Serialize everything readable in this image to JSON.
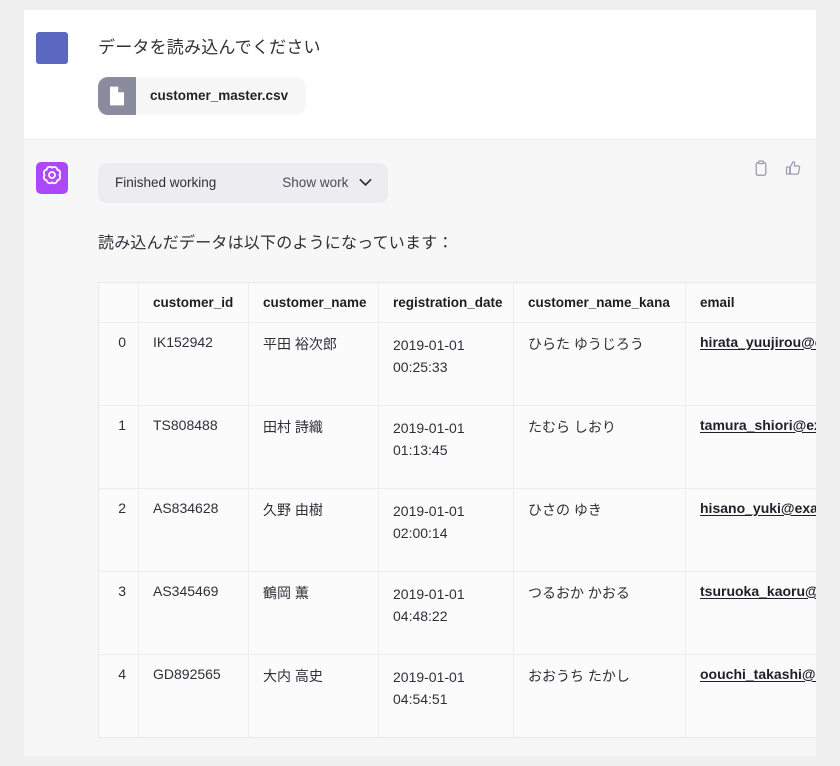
{
  "user_turn": {
    "avatar_color": "#5b68c0",
    "message": "データを読み込んでください",
    "attachment": {
      "filename": "customer_master.csv",
      "icon": "file-document-icon"
    }
  },
  "assistant_turn": {
    "avatar_color": "#ab47fc",
    "avatar_icon": "openai-logo-icon",
    "work_bar": {
      "status": "Finished working",
      "toggle_label": "Show work",
      "toggle_icon": "chevron-down-icon"
    },
    "actions": [
      {
        "name": "copy-icon",
        "label": "Copy"
      },
      {
        "name": "thumbs-up-icon",
        "label": "Good response"
      }
    ],
    "message": "読み込んだデータは以下のようになっています："
  },
  "table": {
    "index_header": "",
    "columns": [
      "customer_id",
      "customer_name",
      "registration_date",
      "customer_name_kana",
      "email"
    ],
    "rows": [
      {
        "index": "0",
        "customer_id": "IK152942",
        "customer_name": "平田 裕次郎",
        "registration_date_date": "2019-01-01",
        "registration_date_time": "00:25:33",
        "customer_name_kana": "ひらた ゆうじろう",
        "email": "hirata_yuujirou@example.com"
      },
      {
        "index": "1",
        "customer_id": "TS808488",
        "customer_name": "田村 詩織",
        "registration_date_date": "2019-01-01",
        "registration_date_time": "01:13:45",
        "customer_name_kana": "たむら しおり",
        "email": "tamura_shiori@example.com"
      },
      {
        "index": "2",
        "customer_id": "AS834628",
        "customer_name": "久野 由樹",
        "registration_date_date": "2019-01-01",
        "registration_date_time": "02:00:14",
        "customer_name_kana": "ひさの ゆき",
        "email": "hisano_yuki@example.com"
      },
      {
        "index": "3",
        "customer_id": "AS345469",
        "customer_name": "鶴岡 薫",
        "registration_date_date": "2019-01-01",
        "registration_date_time": "04:48:22",
        "customer_name_kana": "つるおか かおる",
        "email": "tsuruoka_kaoru@example.com"
      },
      {
        "index": "4",
        "customer_id": "GD892565",
        "customer_name": "大内 高史",
        "registration_date_date": "2019-01-01",
        "registration_date_time": "04:54:51",
        "customer_name_kana": "おおうち たかし",
        "email": "oouchi_takashi@example.com"
      }
    ]
  }
}
